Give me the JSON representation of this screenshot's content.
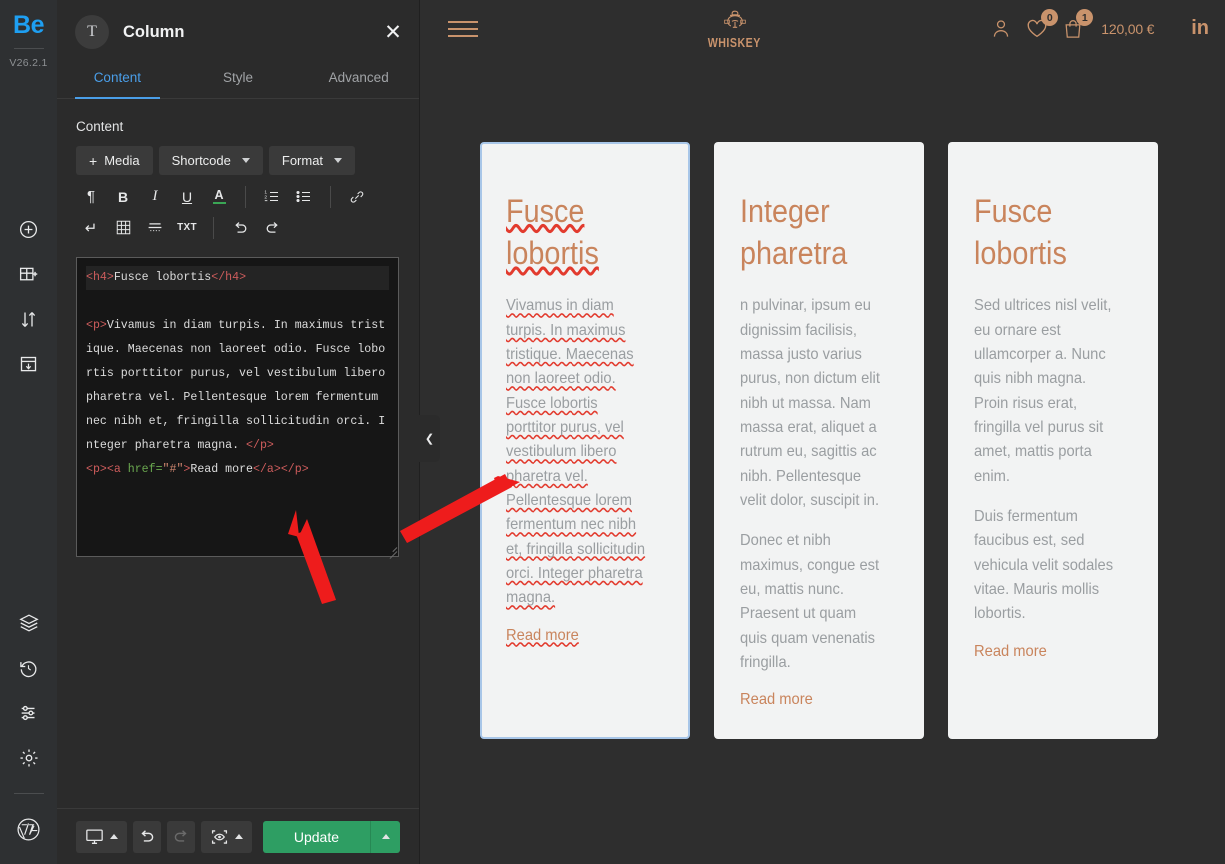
{
  "rail": {
    "logo": "Be",
    "version": "V26.2.1",
    "top_icons": [
      {
        "name": "add-element-icon",
        "label": "Add element"
      },
      {
        "name": "add-section-icon",
        "label": "Add section"
      },
      {
        "name": "reorder-icon",
        "label": "Reorder"
      },
      {
        "name": "import-icon",
        "label": "Import"
      }
    ],
    "bottom_icons": [
      {
        "name": "layers-icon",
        "label": "Layers"
      },
      {
        "name": "history-icon",
        "label": "History"
      },
      {
        "name": "settings-sliders-icon",
        "label": "Global settings"
      },
      {
        "name": "gear-icon",
        "label": "Options"
      },
      {
        "name": "wordpress-icon",
        "label": "WordPress"
      }
    ]
  },
  "panel": {
    "avatar_glyph": "T",
    "title": "Column",
    "close_label": "✕",
    "tabs": [
      {
        "label": "Content",
        "active": true
      },
      {
        "label": "Style",
        "active": false
      },
      {
        "label": "Advanced",
        "active": false
      }
    ],
    "section_label": "Content",
    "buttons": {
      "media": "Media",
      "media_plus": "+",
      "shortcode": "Shortcode",
      "format": "Format"
    },
    "toolbar_row1": [
      {
        "name": "paragraph-icon",
        "glyph": "¶"
      },
      {
        "name": "bold-icon",
        "glyph": "B"
      },
      {
        "name": "italic-icon",
        "glyph": "I"
      },
      {
        "name": "underline-icon",
        "glyph": "U"
      },
      {
        "name": "text-color-icon",
        "glyph": "A"
      },
      {
        "name": "ordered-list-icon",
        "glyph": "ol"
      },
      {
        "name": "unordered-list-icon",
        "glyph": "ul"
      },
      {
        "name": "link-icon",
        "glyph": "link"
      }
    ],
    "toolbar_row2": [
      {
        "name": "line-break-icon",
        "glyph": "↵"
      },
      {
        "name": "table-icon",
        "glyph": "table"
      },
      {
        "name": "horizontal-rule-icon",
        "glyph": "hr"
      },
      {
        "name": "text-mode-icon",
        "glyph": "TXT"
      },
      {
        "name": "undo-icon",
        "glyph": "↶"
      },
      {
        "name": "redo-icon",
        "glyph": "↷"
      }
    ],
    "code": {
      "line1_open": "<h4>",
      "line1_text": "Fusce lobortis",
      "line1_close": "</h4>",
      "line2_open": "<p>",
      "line2_text": "Vivamus in diam turpis. In maximus tristique. Maecenas non laoreet odio. Fusce lobortis porttitor purus, vel vestibulum libero pharetra vel. Pellentesque lorem fermentum nec nibh et, fringilla sollicitudin orci. Integer pharetra magna. ",
      "line2_close": "</p>",
      "line3_p": "<p>",
      "line3_a_open": "<a ",
      "line3_attr": "href=",
      "line3_val": "\"#\"",
      "line3_gt": ">",
      "line3_text": "Read more",
      "line3_close": "</a></p>"
    },
    "collapse_glyph": "❮"
  },
  "footer": {
    "device_icon": "desktop-icon",
    "undo_icon": "undo-icon",
    "redo_icon": "redo-icon",
    "preview_icon": "preview-eye-icon",
    "update_label": "Update"
  },
  "site": {
    "nav": {
      "menu_icon": "hamburger-menu-icon",
      "brand_name": "WHISKEY",
      "brand_logo": "whiskey-man-logo",
      "account_icon": "user-account-icon",
      "wishlist_icon": "heart-icon",
      "wishlist_count": "0",
      "cart_icon": "shopping-bag-icon",
      "cart_count": "1",
      "cart_price": "120,00 €",
      "linkedin_label": "in"
    },
    "cards": [
      {
        "selected": true,
        "title": "Fusce lobortis",
        "paragraphs": [
          "Vivamus in diam turpis. In maximus tristique. Maecenas non laoreet odio. Fusce lobortis porttitor purus, vel vestibulum libero pharetra vel. Pellentesque lorem fermentum nec nibh et, fringilla sollicitudin orci. Integer pharetra magna."
        ],
        "readmore": "Read more"
      },
      {
        "selected": false,
        "title": "Integer pharetra",
        "paragraphs": [
          "n pulvinar, ipsum eu dignissim facilisis, massa justo varius purus, non dictum elit nibh ut massa. Nam massa erat, aliquet a rutrum eu, sagittis ac nibh. Pellentesque velit dolor, suscipit in.",
          "Donec et nibh maximus, congue est eu, mattis nunc. Praesent ut quam quis quam venenatis fringilla."
        ],
        "readmore": "Read more"
      },
      {
        "selected": false,
        "title": "Fusce lobortis",
        "paragraphs": [
          "Sed ultrices nisl velit, eu ornare est ullamcorper a. Nunc quis nibh magna. Proin risus erat, fringilla vel purus sit amet, mattis porta enim.",
          "Duis fermentum faucibus est, sed vehicula velit sodales vitae. Mauris mollis lobortis."
        ],
        "readmore": "Read more"
      }
    ]
  },
  "colors": {
    "accent_blue": "#1e9ff2",
    "update_green": "#2e9e63",
    "site_copper": "#c9936c",
    "card_heading": "#c9845c",
    "annotation_red": "#ee1c1c"
  }
}
